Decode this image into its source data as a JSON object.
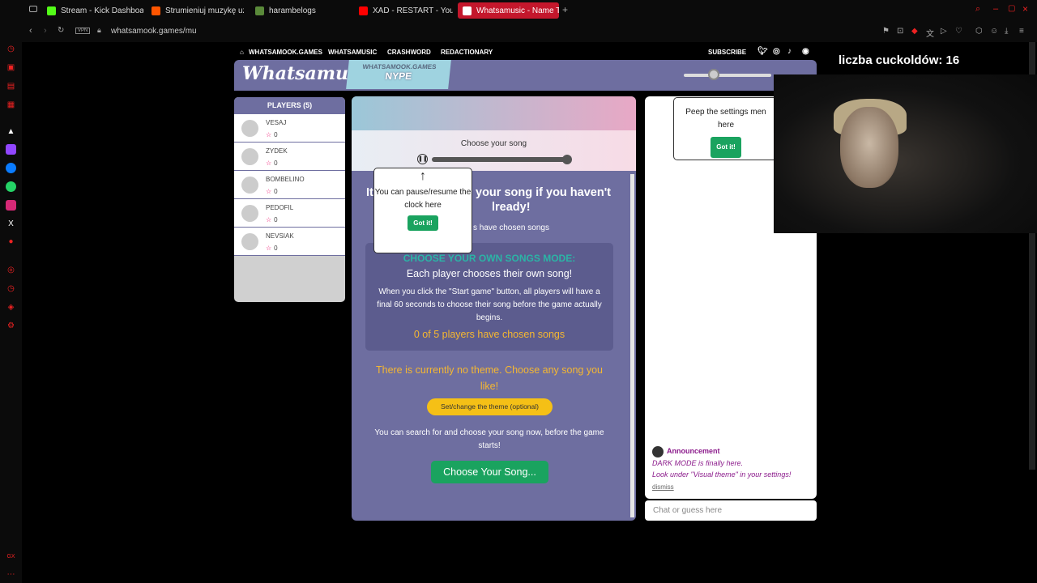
{
  "browser": {
    "tabs": [
      {
        "label": "Stream - Kick Dashboard",
        "color": "#53fc18"
      },
      {
        "label": "Strumieniuj muzykę użyt",
        "color": "#ff5500"
      },
      {
        "label": "harambelogs",
        "color": "#5a8a3a"
      },
      {
        "label": "XAD - RESTART - YouTub",
        "color": "#ff0000"
      },
      {
        "label": "Whatsamusic - Name Tha",
        "color": "#ffffff"
      }
    ],
    "vpn_label": "VPN",
    "url": "whatsamook.games/mu"
  },
  "site_nav": {
    "home": "WHATSAMOOK.GAMES",
    "items": [
      "WHATSAMUSIC",
      "CRASHWORD",
      "REDACTIONARY"
    ],
    "subscribe": "SUBSCRIBE"
  },
  "header": {
    "logo": "Whatsamusic",
    "hype_line1": "WHATSAMOOK.GAMES",
    "hype_line2": "NYPE"
  },
  "players": {
    "title": "PLAYERS (5)",
    "list": [
      {
        "name": "VESAJ",
        "score": "0"
      },
      {
        "name": "ZYDEK",
        "score": "0"
      },
      {
        "name": "BOMBELINO",
        "score": "0"
      },
      {
        "name": "PEDOFIL",
        "score": "0"
      },
      {
        "name": "NEVSIAK",
        "score": "0"
      }
    ]
  },
  "game": {
    "song_title": "Choose your song",
    "heading_left": "It",
    "heading_right": "your song if you haven't",
    "heading_line2": "lready!",
    "chosen_partial": "s have chosen songs",
    "mode_title": "CHOOSE YOUR OWN SONGS MODE:",
    "mode_sub": "Each player chooses their own song!",
    "mode_text": "When you click the \"Start game\" button, all players will have a final 60 seconds to choose their song before the game actually begins.",
    "mode_count": "0 of 5 players have chosen songs",
    "theme_text": "There is currently no theme. Choose any song you like!",
    "theme_button": "Set/change the theme (optional)",
    "search_text": "You can search for and choose your song now, before the game starts!",
    "choose_button": "Choose Your Song..."
  },
  "clock_tip": {
    "text": "You can pause/resume the clock here",
    "button": "Got it!"
  },
  "settings_tip": {
    "text": "Peep the settings men here",
    "button": "Got it!"
  },
  "chat": {
    "announce_title": "Announcement",
    "announce_line1": "DARK MODE is finally here.",
    "announce_line2": "Look under \"Visual theme\" in your settings!",
    "dismiss": "dismiss",
    "placeholder": "Chat or guess here"
  },
  "overlay": {
    "text": "liczba cuckoldów: 16"
  }
}
